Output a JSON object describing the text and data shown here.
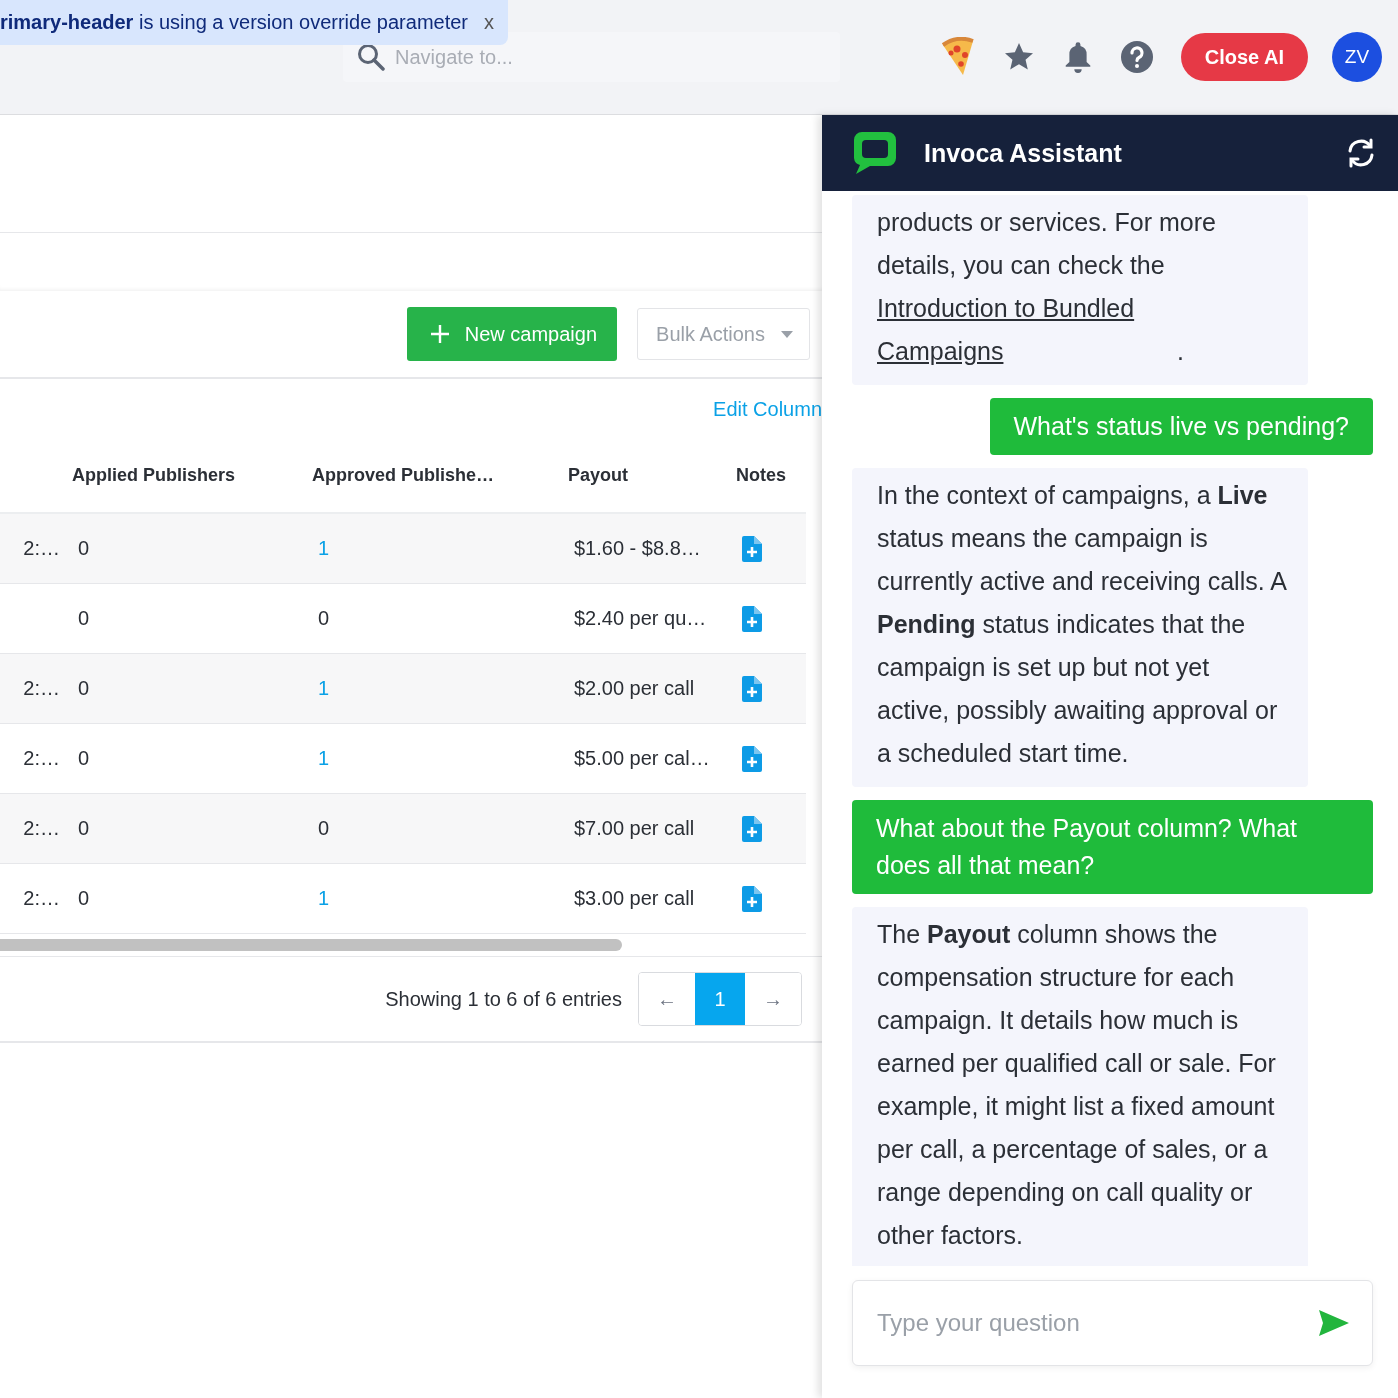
{
  "banner": {
    "text": "**rimary-header** is using a version override parameter",
    "close": "x"
  },
  "topbar": {
    "search": {
      "placeholder": "Navigate to..."
    },
    "close_ai": "Close AI",
    "avatar": "ZV"
  },
  "toolbar": {
    "new_campaign": "New campaign",
    "bulk_actions": "Bulk Actions",
    "edit_columns": "Edit Column"
  },
  "table": {
    "columns": [
      "",
      "Applied Publishers",
      "Approved Publishe…",
      "Payout",
      "Notes"
    ],
    "rows": [
      {
        "column_1": "2:…",
        "applied": "0",
        "approved": "1",
        "approved_link": true,
        "payout": "$1.60 - $8.8…"
      },
      {
        "column_1": "",
        "applied": "0",
        "approved": "0",
        "approved_link": false,
        "payout": "$2.40 per qu…"
      },
      {
        "column_1": "2:…",
        "applied": "0",
        "approved": "1",
        "approved_link": true,
        "payout": "$2.00 per call"
      },
      {
        "column_1": "2:…",
        "applied": "0",
        "approved": "1",
        "approved_link": true,
        "payout": "$5.00 per cal…"
      },
      {
        "column_1": "2:…",
        "applied": "0",
        "approved": "0",
        "approved_link": false,
        "payout": "$7.00 per call"
      },
      {
        "column_1": "2:…",
        "applied": "0",
        "approved": "1",
        "approved_link": true,
        "payout": "$3.00 per call"
      }
    ]
  },
  "pagination": {
    "summary": "Showing 1 to 6 of 6 entries",
    "prev": "←",
    "next": "→",
    "pages": [
      {
        "label": "1",
        "selected": true
      }
    ]
  },
  "assistant": {
    "title": "Invoca Assistant",
    "messages": [
      {
        "kind": "assistant",
        "text": "products or services. For more details, you can check the ",
        "link": "Introduction to Bundled Campaigns",
        "after": "."
      },
      {
        "kind": "user",
        "text": "What's status live vs pending?"
      },
      {
        "kind": "assistant",
        "text": "In the context of campaigns, a **Live** status means the campaign is currently active and receiving calls. A **Pending** status indicates that the campaign is set up but not yet active, possibly awaiting approval or a scheduled start time."
      },
      {
        "kind": "user",
        "text": "What about the Payout column? What does all that mean?"
      },
      {
        "kind": "assistant",
        "text": "The **Payout** column shows the compensation structure for each campaign. It details how much is earned per qualified call or sale. For example, it might list a fixed amount per call, a percentage of sales, or a range depending on call quality or other factors."
      }
    ],
    "input": {
      "placeholder": "Type your question"
    }
  }
}
